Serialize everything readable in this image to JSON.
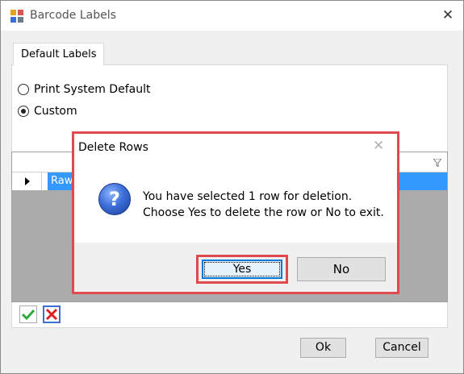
{
  "window": {
    "title": "Barcode Labels",
    "close_glyph": "✕"
  },
  "tabs": [
    {
      "label": "Default Labels",
      "selected": true
    }
  ],
  "options": {
    "print_system_default": {
      "label": "Print System Default",
      "checked": false
    },
    "custom": {
      "label": "Custom",
      "checked": true
    }
  },
  "grid": {
    "filter_icon": "funnel-icon",
    "rows": [
      {
        "cell": "Raw",
        "selected": true
      }
    ]
  },
  "toolbar": {
    "accept_icon": "checkmark-icon",
    "delete_icon": "red-x-icon"
  },
  "footer": {
    "ok_label": "Ok",
    "cancel_label": "Cancel"
  },
  "dialog": {
    "title": "Delete Rows",
    "close_glyph": "✕",
    "icon": "question-icon",
    "message_line1": "You have selected 1 row for deletion.",
    "message_line2": "Choose Yes to delete the row or No to exit.",
    "yes_label": "Yes",
    "no_label": "No"
  },
  "colors": {
    "highlight": "#e0494d",
    "selection": "#3399ff",
    "default_button_border": "#0078d7"
  }
}
